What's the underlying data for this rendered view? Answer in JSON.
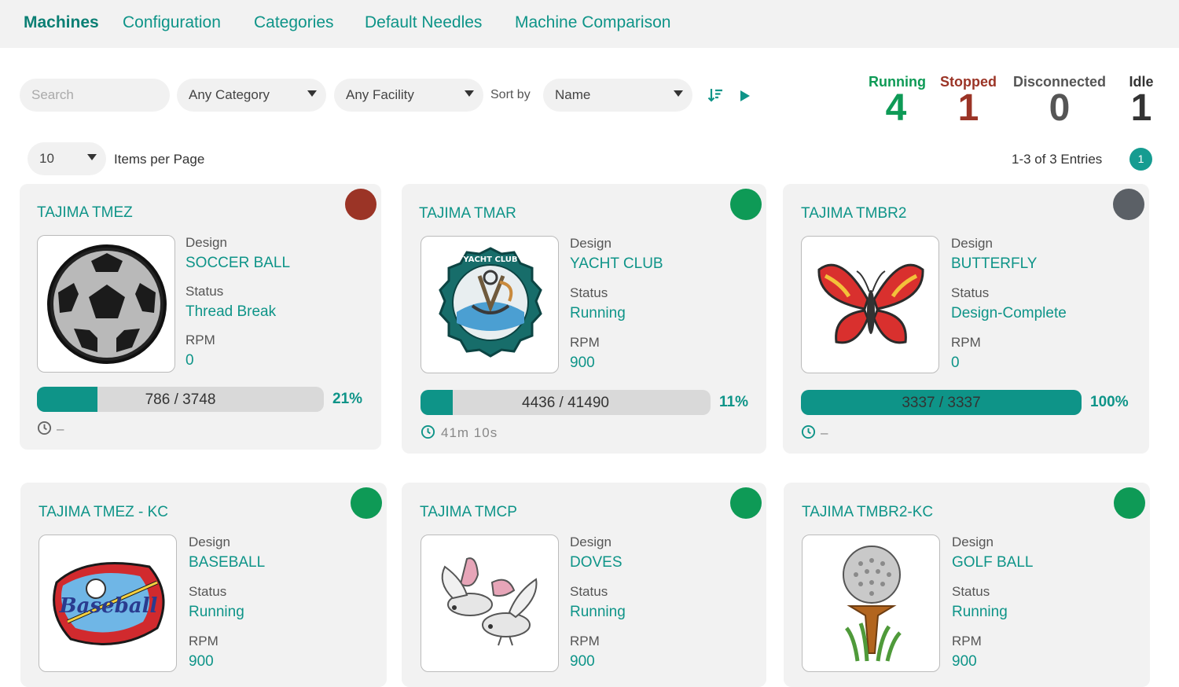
{
  "nav": {
    "tabs": [
      {
        "label": "Machines",
        "active": true
      },
      {
        "label": "Configuration"
      },
      {
        "label": "Categories"
      },
      {
        "label": "Default Needles"
      },
      {
        "label": "Machine Comparison"
      }
    ]
  },
  "filters": {
    "search_placeholder": "Search",
    "category": "Any Category",
    "facility": "Any Facility",
    "sort_label": "Sort by",
    "sort_value": "Name"
  },
  "stats": {
    "running": {
      "label": "Running",
      "value": "4",
      "color": "#0e9a56"
    },
    "stopped": {
      "label": "Stopped",
      "value": "1",
      "color": "#9b3426"
    },
    "disconnected": {
      "label": "Disconnected",
      "value": "0",
      "color": "#555555"
    },
    "idle": {
      "label": "Idle",
      "value": "1",
      "color": "#333333"
    }
  },
  "pagination": {
    "per_page": "10",
    "per_page_label": "Items per Page",
    "entries": "1-3 of 3 Entries",
    "page": "1"
  },
  "card_labels": {
    "design": "Design",
    "status": "Status",
    "rpm": "RPM"
  },
  "machines": [
    {
      "name": "TAJIMA TMEZ",
      "design": "SOCCER BALL",
      "status": "Thread Break",
      "rpm": "0",
      "progress": "786 / 3748",
      "percent": "21%",
      "fraction": 0.21,
      "time": "–",
      "state_color": "#9b3426",
      "image": "soccer-ball-icon"
    },
    {
      "name": "TAJIMA TMAR",
      "design": "YACHT CLUB",
      "status": "Running",
      "rpm": "900",
      "progress": "4436 / 41490",
      "percent": "11%",
      "fraction": 0.11,
      "time": "41m 10s",
      "state_color": "#0e9a56",
      "image": "yacht-club-patch-icon"
    },
    {
      "name": "TAJIMA TMBR2",
      "design": "BUTTERFLY",
      "status": "Design-Complete",
      "rpm": "0",
      "progress": "3337 / 3337",
      "percent": "100%",
      "fraction": 1.0,
      "time": "–",
      "state_color": "#5b6066",
      "image": "butterfly-icon"
    },
    {
      "name": "TAJIMA TMEZ - KC",
      "design": "BASEBALL",
      "status": "Running",
      "rpm": "900",
      "state_color": "#0e9a56",
      "image": "baseball-patch-icon"
    },
    {
      "name": "TAJIMA TMCP",
      "design": "DOVES",
      "status": "Running",
      "rpm": "900",
      "state_color": "#0e9a56",
      "image": "doves-icon"
    },
    {
      "name": "TAJIMA TMBR2-KC",
      "design": "GOLF BALL",
      "status": "Running",
      "rpm": "900",
      "state_color": "#0e9a56",
      "image": "golf-ball-icon"
    }
  ]
}
